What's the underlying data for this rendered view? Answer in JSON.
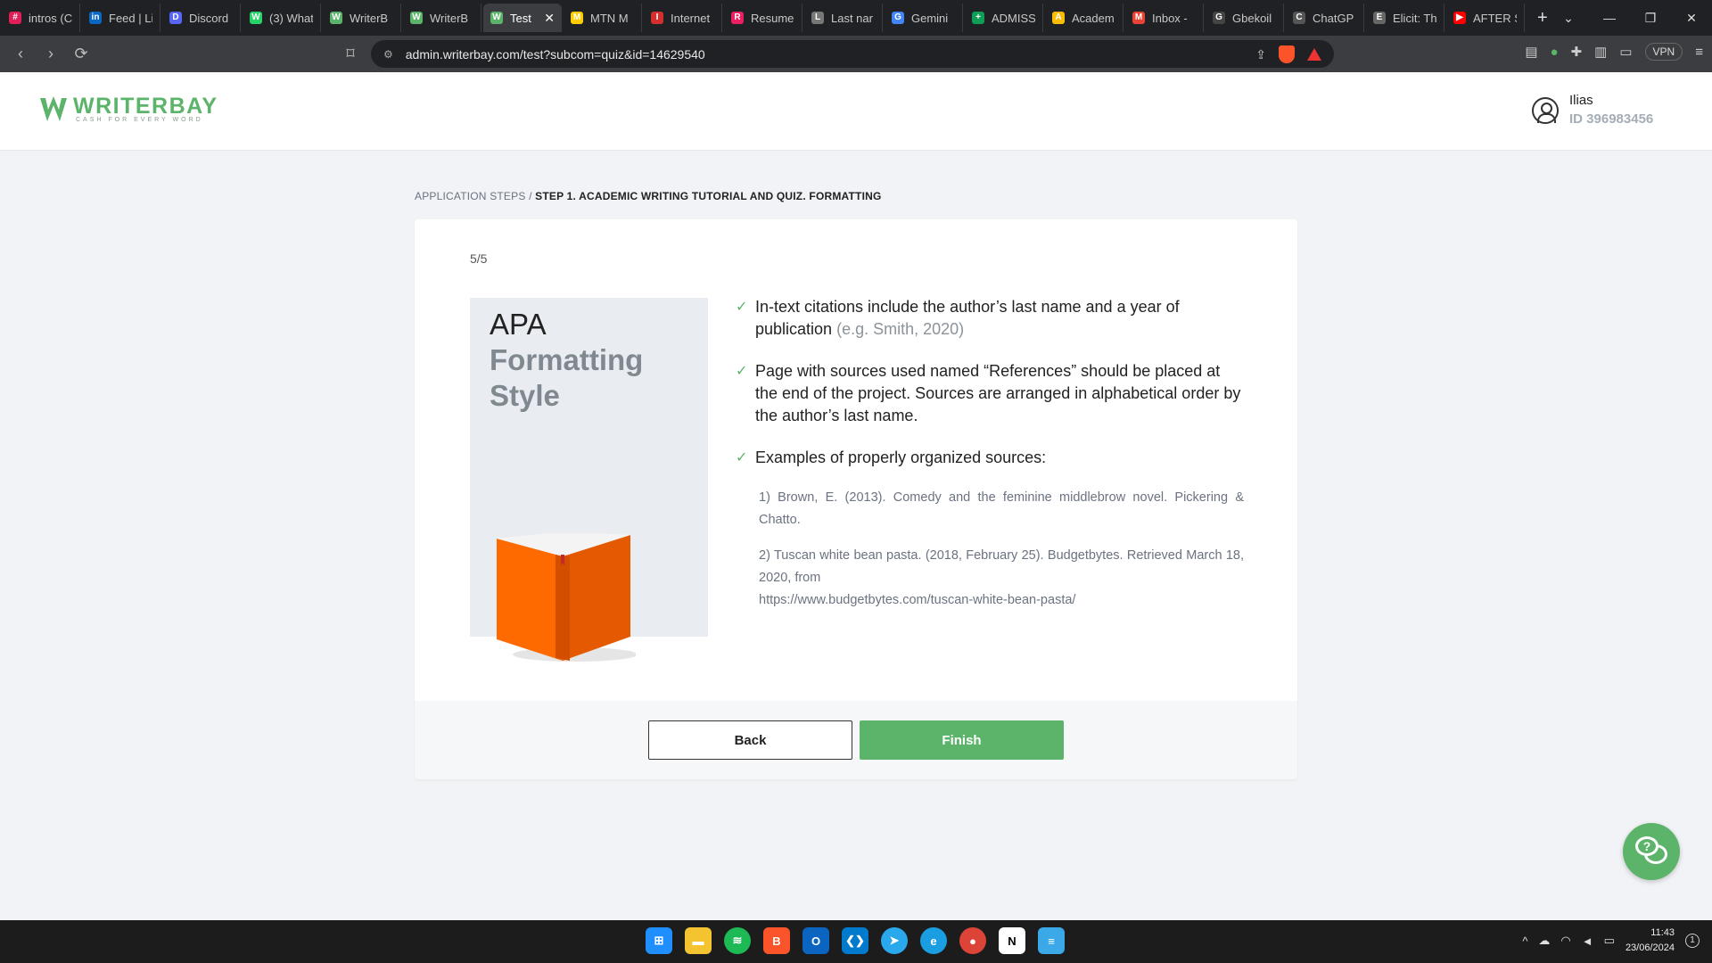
{
  "browser": {
    "tabs": [
      {
        "label": "intros (C",
        "color": "#e01e5a",
        "glyph": "#"
      },
      {
        "label": "Feed | Li",
        "color": "#0a66c2",
        "glyph": "in"
      },
      {
        "label": "Discord",
        "color": "#5865f2",
        "glyph": "D"
      },
      {
        "label": "(3) What",
        "color": "#25d366",
        "glyph": "W"
      },
      {
        "label": "WriterB",
        "color": "#5cb46a",
        "glyph": "W"
      },
      {
        "label": "WriterB",
        "color": "#5cb46a",
        "glyph": "W"
      },
      {
        "label": "Test",
        "color": "#5cb46a",
        "glyph": "W",
        "active": true
      },
      {
        "label": "MTN M",
        "color": "#ffcc00",
        "glyph": "M"
      },
      {
        "label": "Internet",
        "color": "#d32f2f",
        "glyph": "I"
      },
      {
        "label": "Resume",
        "color": "#e91e63",
        "glyph": "R"
      },
      {
        "label": "Last nar",
        "color": "#777777",
        "glyph": "L"
      },
      {
        "label": "Gemini",
        "color": "#4285f4",
        "glyph": "G"
      },
      {
        "label": "ADMISS",
        "color": "#0f9d58",
        "glyph": "+"
      },
      {
        "label": "Academ",
        "color": "#fbbc04",
        "glyph": "A"
      },
      {
        "label": "Inbox -",
        "color": "#ea4335",
        "glyph": "M"
      },
      {
        "label": "Gbekoil",
        "color": "#444444",
        "glyph": "G"
      },
      {
        "label": "ChatGP",
        "color": "#555555",
        "glyph": "C"
      },
      {
        "label": "Elicit: Th",
        "color": "#666666",
        "glyph": "E"
      },
      {
        "label": "AFTER S",
        "color": "#ff0000",
        "glyph": "▶"
      }
    ],
    "new_tab": "+",
    "url": "admin.writerbay.com/test?subcom=quiz&id=14629540",
    "vpn_label": "VPN"
  },
  "site": {
    "logo_name": "WRITERBAY",
    "logo_tagline": "CASH FOR EVERY WORD",
    "user_name": "Ilias",
    "user_id": "ID 396983456"
  },
  "breadcrumb": {
    "parent": "APPLICATION STEPS",
    "separator": " / ",
    "current": "STEP 1. ACADEMIC WRITING TUTORIAL AND QUIZ. FORMATTING"
  },
  "quiz": {
    "progress": "5/5",
    "illustration": {
      "title_line1": "APA",
      "title_line2": "Formatting",
      "title_line3": "Style",
      "book_color": "#ff6a00"
    },
    "bullets": [
      {
        "text": "In-text citations include the author’s last name and a year of publication ",
        "hint": "(e.g. Smith, 2020)"
      },
      {
        "text": "Page with sources used named “References” should be placed at the end of the project. Sources are arranged in alphabetical order by the author’s last name.",
        "hint": ""
      },
      {
        "text": "Examples of properly organized sources:",
        "hint": ""
      }
    ],
    "references": [
      {
        "text": "1) Brown, E. (2013). Comedy and the feminine middlebrow novel. Pickering & Chatto.",
        "link": ""
      },
      {
        "text": "2) Tuscan white bean pasta. (2018, February 25). Budgetbytes. Retrieved March 18, 2020, from",
        "link": "https://www.budgetbytes.com/tuscan-white-bean-pasta/"
      }
    ],
    "back_label": "Back",
    "finish_label": "Finish"
  },
  "colors": {
    "brand_green": "#5cb46a",
    "page_bg": "#f1f3f6"
  },
  "taskbar": {
    "time": "11:43",
    "date": "23/06/2024",
    "notifications": "1"
  }
}
